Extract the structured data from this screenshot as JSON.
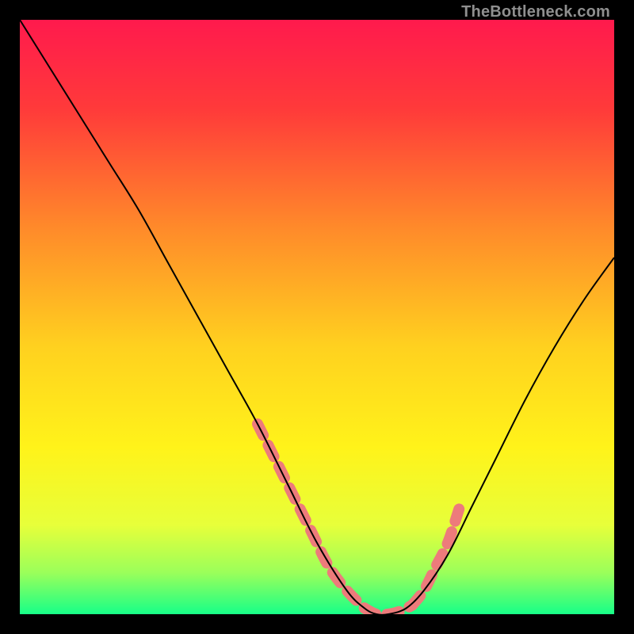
{
  "watermark": "TheBottleneck.com",
  "chart_data": {
    "type": "line",
    "title": "",
    "xlabel": "",
    "ylabel": "",
    "xlim": [
      0,
      100
    ],
    "ylim": [
      0,
      100
    ],
    "grid": false,
    "legend": false,
    "background_gradient": {
      "stops": [
        {
          "offset": 0.0,
          "color": "#ff1a4d"
        },
        {
          "offset": 0.15,
          "color": "#ff3a3a"
        },
        {
          "offset": 0.35,
          "color": "#ff8a2a"
        },
        {
          "offset": 0.55,
          "color": "#ffd11f"
        },
        {
          "offset": 0.72,
          "color": "#fff31a"
        },
        {
          "offset": 0.85,
          "color": "#e7ff3a"
        },
        {
          "offset": 0.93,
          "color": "#9bff5a"
        },
        {
          "offset": 1.0,
          "color": "#17ff88"
        }
      ]
    },
    "series": [
      {
        "name": "bottleneck-curve",
        "color": "#000000",
        "x": [
          0,
          5,
          10,
          15,
          20,
          25,
          30,
          35,
          40,
          45,
          50,
          55,
          58,
          60,
          62,
          65,
          68,
          72,
          76,
          80,
          85,
          90,
          95,
          100
        ],
        "y": [
          100,
          92,
          84,
          76,
          68,
          59,
          50,
          41,
          32,
          22,
          12,
          4,
          1,
          0,
          0,
          1,
          4,
          10,
          18,
          26,
          36,
          45,
          53,
          60
        ]
      }
    ],
    "highlight_segments": [
      {
        "name": "descending-tip-highlight",
        "color": "#ed7b7b",
        "x": [
          40,
          43,
          46,
          49,
          52,
          55,
          58
        ],
        "y": [
          32,
          26,
          20,
          14,
          8,
          4,
          1
        ]
      },
      {
        "name": "valley-floor-highlight",
        "color": "#ed7b7b",
        "x": [
          58,
          60,
          62,
          64,
          66
        ],
        "y": [
          1,
          0,
          0,
          0.5,
          1.5
        ]
      },
      {
        "name": "ascending-tip-highlight",
        "color": "#ed7b7b",
        "x": [
          66,
          68,
          70,
          72,
          74
        ],
        "y": [
          1.5,
          4,
          8,
          12,
          18
        ]
      }
    ]
  }
}
